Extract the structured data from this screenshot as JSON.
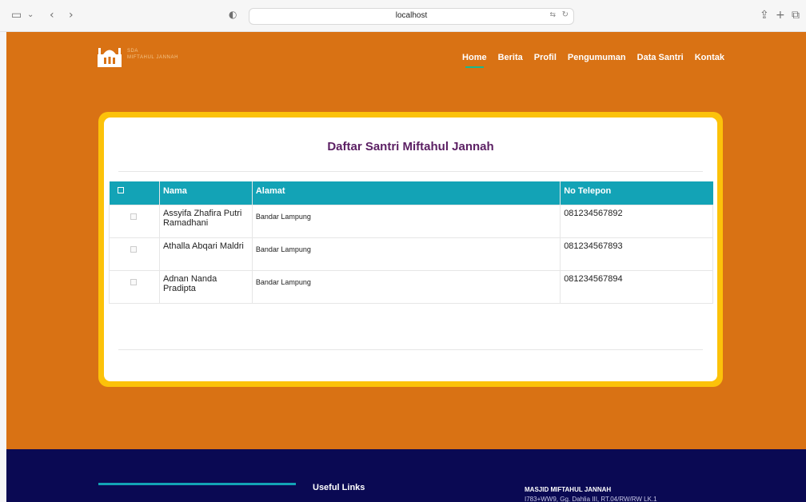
{
  "browser": {
    "url": "localhost",
    "translate_icon": "translate-icon",
    "reload_icon": "reload-icon"
  },
  "brand": {
    "line1": "SDA",
    "line2": "MIFTAHUL JANNAH"
  },
  "nav": {
    "items": [
      "Home",
      "Berita",
      "Profil",
      "Pengumuman",
      "Data Santri",
      "Kontak"
    ],
    "active": "Home"
  },
  "main": {
    "title": "Daftar Santri Miftahul Jannah",
    "columns": [
      "Nama",
      "Alamat",
      "No Telepon"
    ],
    "rows": [
      {
        "nama": "Assyifa Zhafira Putri Ramadhani",
        "alamat": "Bandar Lampung",
        "telepon": "081234567892"
      },
      {
        "nama": "Athalla Abqari Maldri",
        "alamat": "Bandar Lampung",
        "telepon": "081234567893"
      },
      {
        "nama": "Adnan Nanda Pradipta",
        "alamat": "Bandar Lampung",
        "telepon": "081234567894"
      }
    ]
  },
  "footer": {
    "useful_links": "Useful Links",
    "masjid": "MASJID MIFTAHUL JANNAH",
    "address": "I783+WW9, Gg. Dahlia III, RT.04/RW/RW LK.1"
  },
  "colors": {
    "page_bg": "#d97214",
    "card_border": "#fcc20a",
    "table_header": "#13a3b6",
    "title": "#5b1f63",
    "footer_bg": "#0a0953",
    "nav_underline": "#16b98f"
  }
}
